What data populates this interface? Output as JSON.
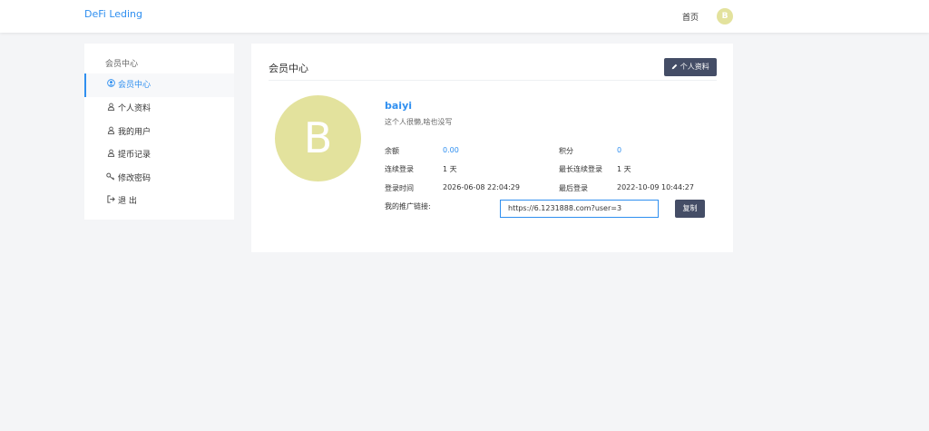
{
  "header": {
    "brand": "DeFi Leding",
    "home_label": "首页",
    "avatar_letter": "B"
  },
  "sidebar": {
    "title": "会员中心",
    "items": [
      {
        "label": "会员中心",
        "icon": "user-circle-icon",
        "active": true
      },
      {
        "label": "个人资料",
        "icon": "user-icon",
        "active": false
      },
      {
        "label": "我的用户",
        "icon": "user-icon",
        "active": false
      },
      {
        "label": "提币记录",
        "icon": "user-icon",
        "active": false
      },
      {
        "label": "修改密码",
        "icon": "key-icon",
        "active": false
      },
      {
        "label": "退 出",
        "icon": "sign-out-icon",
        "active": false
      }
    ]
  },
  "main": {
    "title": "会员中心",
    "edit_button": "个人资料",
    "avatar_letter": "B",
    "username": "baiyi",
    "bio": "这个人很懒,啥也没写",
    "stats": {
      "balance_label": "余额",
      "balance_value": "0.00",
      "points_label": "积分",
      "points_value": "0",
      "streak_label": "连续登录",
      "streak_value": "1 天",
      "max_streak_label": "最长连续登录",
      "max_streak_value": "1 天",
      "login_time_label": "登录时间",
      "login_time_value": "2026-06-08 22:04:29",
      "last_login_label": "最后登录",
      "last_login_value": "2022-10-09 10:44:27"
    },
    "referral": {
      "label": "我的推广链接:",
      "url": "https://6.1231888.com?user=3",
      "copy_button": "复制"
    }
  },
  "colors": {
    "accent": "#2f8ff0",
    "button": "#444d66",
    "avatar": "#e3e29d"
  }
}
